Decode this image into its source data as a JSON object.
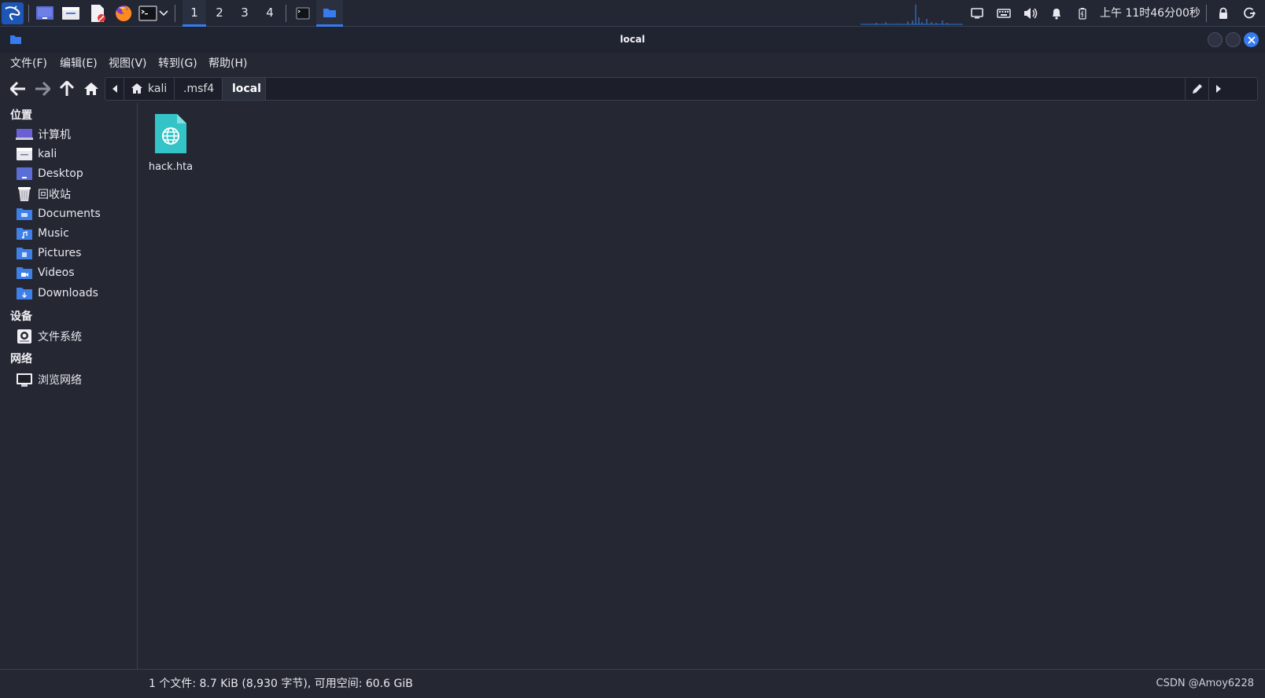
{
  "taskbar": {
    "workspaces": [
      "1",
      "2",
      "3",
      "4"
    ],
    "active_workspace": "1",
    "clock": "上午 11时46分00秒",
    "icons": [
      "kali-menu-icon",
      "desktop-icon",
      "file-manager-icon",
      "text-editor-icon",
      "firefox-icon",
      "terminal-icon",
      "dropdown-icon"
    ],
    "tray_icons": [
      "display-icon",
      "keyboard-icon",
      "volume-icon",
      "bell-icon",
      "battery-icon",
      "lock-icon",
      "power-icon"
    ]
  },
  "window": {
    "title": "local"
  },
  "menubar": {
    "file": "文件(F)",
    "edit": "编辑(E)",
    "view": "视图(V)",
    "go": "转到(G)",
    "help": "帮助(H)"
  },
  "pathbar": {
    "crumbs": [
      "kali",
      ".msf4",
      "local"
    ]
  },
  "sidebar": {
    "places_header": "位置",
    "places": [
      "计算机",
      "kali",
      "Desktop",
      "回收站",
      "Documents",
      "Music",
      "Pictures",
      "Videos",
      "Downloads"
    ],
    "devices_header": "设备",
    "devices": [
      "文件系统"
    ],
    "network_header": "网络",
    "network": [
      "浏览网络"
    ]
  },
  "files": [
    {
      "name": "hack.hta",
      "icon": "html-file-icon"
    }
  ],
  "statusbar": {
    "summary": "1 个文件: 8.7 KiB (8,930 字节), 可用空间: 60.6 GiB",
    "watermark": "CSDN @Amoy6228"
  },
  "colors": {
    "accent": "#367bf0",
    "background": "#252833",
    "folder": "#5294e2",
    "file_icon": "#34c3c6"
  }
}
